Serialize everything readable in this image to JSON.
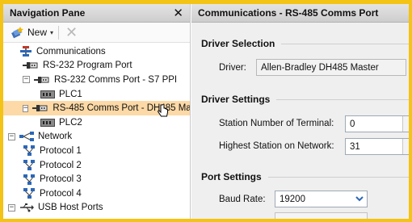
{
  "nav": {
    "title": "Navigation Pane",
    "close_glyph": "✕",
    "toolbar": {
      "new_label": "New",
      "new_caret": "▾",
      "delete_glyph": "✕"
    },
    "tree": [
      {
        "label": "Communications",
        "icon": "communications-icon",
        "expander": "",
        "level": 0
      },
      {
        "label": "RS-232 Program Port",
        "icon": "serial-port-icon",
        "expander": "",
        "level": 1
      },
      {
        "label": "RS-232 Comms Port - S7 PPI",
        "icon": "serial-port-icon",
        "expander": "−",
        "level": 1
      },
      {
        "label": "PLC1",
        "icon": "plc-device-icon",
        "expander": "",
        "level": 2
      },
      {
        "label": "RS-485 Comms Port - DH485 Mas",
        "icon": "serial-port-icon",
        "expander": "−",
        "level": 1,
        "selected": true
      },
      {
        "label": "PLC2",
        "icon": "plc-device-icon",
        "expander": "",
        "level": 2
      },
      {
        "label": "Network",
        "icon": "network-icon",
        "expander": "−",
        "level": 0
      },
      {
        "label": "Protocol 1",
        "icon": "protocol-icon",
        "expander": "",
        "level": 1
      },
      {
        "label": "Protocol 2",
        "icon": "protocol-icon",
        "expander": "",
        "level": 1
      },
      {
        "label": "Protocol 3",
        "icon": "protocol-icon",
        "expander": "",
        "level": 1
      },
      {
        "label": "Protocol 4",
        "icon": "protocol-icon",
        "expander": "",
        "level": 1
      },
      {
        "label": "USB Host Ports",
        "icon": "usb-icon",
        "expander": "−",
        "level": 0
      }
    ]
  },
  "panel": {
    "title": "Communications - RS-485 Comms Port",
    "driver_section": "Driver Selection",
    "driver_label": "Driver:",
    "driver_value": "Allen-Bradley DH485 Master",
    "settings_section": "Driver Settings",
    "station_label": "Station Number of Terminal:",
    "station_value": "0",
    "highest_label": "Highest Station on Network:",
    "highest_value": "31",
    "port_section": "Port Settings",
    "baud_label": "Baud Rate:",
    "baud_value": "19200"
  },
  "colors": {
    "highlight_border": "#f3c316",
    "selection": "#fcd9a6",
    "icon_blue": "#2b67b8"
  }
}
